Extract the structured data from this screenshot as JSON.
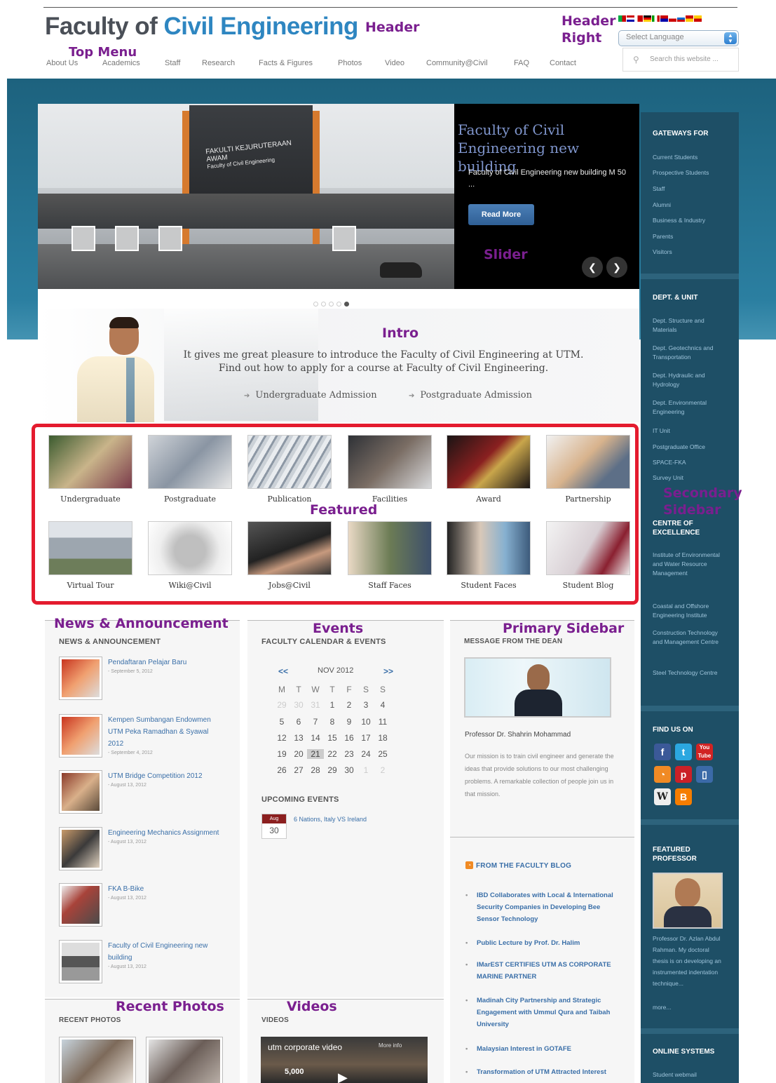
{
  "header": {
    "title_part1": "Faculty of",
    "title_part2": "Civil Engineering",
    "label_header": "Header",
    "label_header_right_1": "Header",
    "label_header_right_2": "Right",
    "label_top_menu": "Top Menu",
    "language_select": "Select Language",
    "search_placeholder": "Search this website ..."
  },
  "menu": [
    "About Us",
    "Academics",
    "Staff",
    "Research",
    "Facts & Figures",
    "Photos",
    "Video",
    "Community@Civil",
    "FAQ",
    "Contact"
  ],
  "slider": {
    "title": "Faculty of Civil Engineering new building",
    "body": "Faculty of Civil Engineering new building M 50 ...",
    "read_more": "Read More",
    "label": "Slider",
    "sign": "FAKULTI KEJURUTERAAN AWAM",
    "sign2": "Faculty of Civil Engineering",
    "active_slide": 5,
    "slide_count": 5
  },
  "intro": {
    "label": "Intro",
    "line1": "It gives me great pleasure to introduce the Faculty of Civil Engineering at UTM.",
    "line2": "Find out how to apply for a course at Faculty of Civil Engineering.",
    "link_undergrad": "Undergraduate Admission",
    "link_postgrad": "Postgraduate Admission"
  },
  "featured": {
    "label": "Featured",
    "row1": [
      "Undergraduate",
      "Postgraduate",
      "Publication",
      "Facilities",
      "Award",
      "Partnership"
    ],
    "row2": [
      "Virtual Tour",
      "Wiki@Civil",
      "Jobs@Civil",
      "Staff Faces",
      "Student Faces",
      "Student Blog"
    ]
  },
  "news": {
    "label": "News & Announcement",
    "heading": "NEWS & ANNOUNCEMENT",
    "items": [
      {
        "title": "Pendaftaran Pelajar Baru",
        "date": "- September 5, 2012"
      },
      {
        "title": "Kempen Sumbangan Endowmen UTM Peka Ramadhan & Syawal 2012",
        "date": "- September 4, 2012"
      },
      {
        "title": "UTM Bridge Competition 2012",
        "date": "- August 13, 2012"
      },
      {
        "title": "Engineering Mechanics Assignment",
        "date": "- August 13, 2012"
      },
      {
        "title": "FKA B-Bike",
        "date": "- August 13, 2012"
      },
      {
        "title": "Faculty of Civil Engineering new building",
        "date": "- August 13, 2012"
      }
    ]
  },
  "events": {
    "label": "Events",
    "heading": "FACULTY CALENDAR & EVENTS",
    "prev": "<<",
    "next": ">>",
    "month": "NOV 2012",
    "weekdays": [
      "M",
      "T",
      "W",
      "T",
      "F",
      "S",
      "S"
    ],
    "weeks": [
      [
        "29",
        "30",
        "31",
        "1",
        "2",
        "3",
        "4"
      ],
      [
        "5",
        "6",
        "7",
        "8",
        "9",
        "10",
        "11"
      ],
      [
        "12",
        "13",
        "14",
        "15",
        "16",
        "17",
        "18"
      ],
      [
        "19",
        "20",
        "21",
        "22",
        "23",
        "24",
        "25"
      ],
      [
        "26",
        "27",
        "28",
        "29",
        "30",
        "1",
        "2"
      ]
    ],
    "today": "21",
    "upcoming_heading": "UPCOMING EVENTS",
    "upcoming_month": "Aug",
    "upcoming_day": "30",
    "upcoming_title": "6 Nations, Italy VS Ireland"
  },
  "primary_sidebar": {
    "label": "Primary Sidebar",
    "dean_heading": "MESSAGE FROM THE DEAN",
    "dean_name": "Professor Dr. Shahrin Mohammad",
    "dean_text": "Our mission is to train civil engineer and generate the ideas that provide solutions to our most challenging problems. A remarkable collection of people join us in that mission.",
    "blog_heading": "FROM THE FACULTY BLOG",
    "blog_items": [
      "IBD Collaborates with Local & International Security Companies in Developing Bee Sensor Technology",
      "Public Lecture by Prof. Dr. Halim",
      "IMarEST CERTIFIES UTM AS CORPORATE MARINE PARTNER",
      "Madinah City Partnership and Strategic Engagement with Ummul Qura and Taibah University",
      "Malaysian Interest in GOTAFE",
      "Transformation of UTM Attracted Interest"
    ]
  },
  "recent_photos": {
    "label": "Recent Photos",
    "heading": "RECENT PHOTOS"
  },
  "videos": {
    "label": "Videos",
    "heading": "VIDEOS",
    "video_title": "utm corporate video",
    "more_info": "More info",
    "overlay": "5,000"
  },
  "secondary_sidebar": {
    "label1": "Secondary",
    "label2": "Sidebar",
    "gateways_heading": "GATEWAYS FOR",
    "gateways": [
      "Current Students",
      "Prospective Students",
      "Staff",
      "Alumni",
      "Business & Industry",
      "Parents",
      "Visitors"
    ],
    "dept_heading": "DEPT. & UNIT",
    "depts": [
      "Dept. Structure and Materials",
      "Dept. Geotechnics and Transportation",
      "Dept. Hydraulic and Hydrology",
      "Dept. Environmental Engineering",
      "IT Unit",
      "Postgraduate Office",
      "SPACE-FKA",
      "Survey Unit"
    ],
    "centre_heading": "CENTRE OF EXCELLENCE",
    "centres": [
      "Institute of Environmental and Water Resource Management",
      "Coastal and Offshore Engineering Institute",
      "Construction Technology and Management Centre",
      "Steel Technology Centre"
    ],
    "find_heading": "FIND US ON",
    "featured_prof_heading": "FEATURED PROFESSOR",
    "prof_text": "Professor Dr. Azlan Abdul Rahman. My doctoral thesis is on developing an instrumented indentation technique...",
    "prof_more": "more...",
    "online_heading": "ONLINE SYSTEMS",
    "online_first": "Student webmail"
  },
  "colors": {
    "band": "#1d627e",
    "sidebar": "#1e4f66",
    "accent_red": "#e41b2e",
    "annotation": "#7a1f8f",
    "link": "#3a6fa8"
  }
}
